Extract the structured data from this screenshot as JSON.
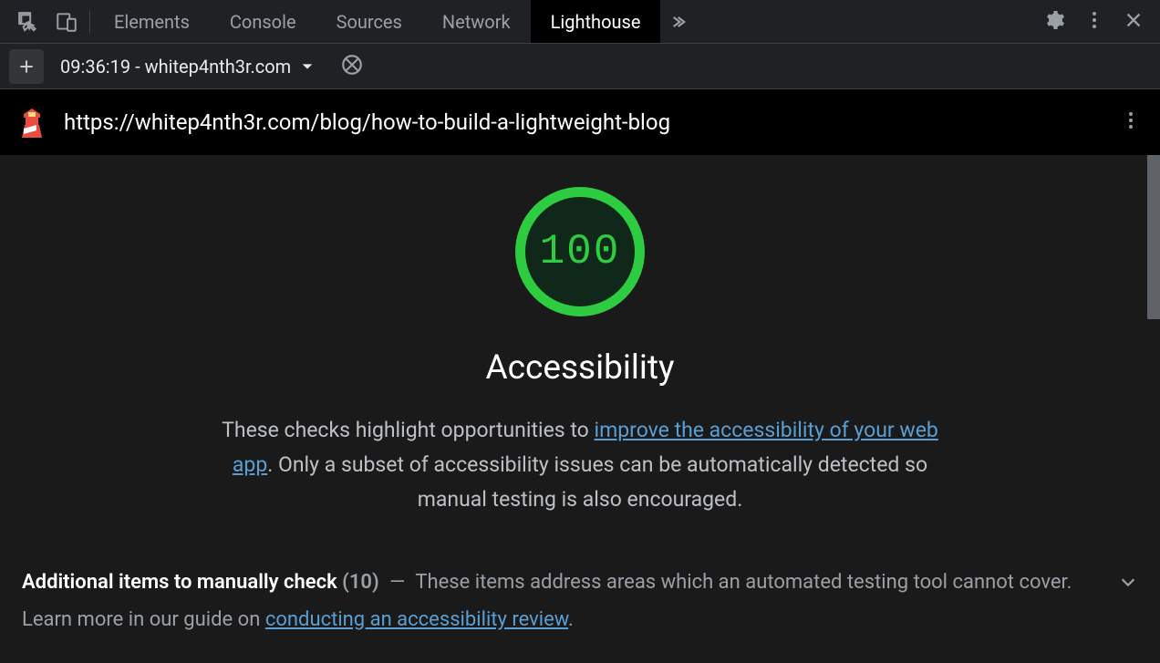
{
  "tabs": {
    "elements": "Elements",
    "console": "Console",
    "sources": "Sources",
    "network": "Network",
    "lighthouse": "Lighthouse"
  },
  "secondaryBar": {
    "reportLabel": "09:36:19 - whitep4nth3r.com"
  },
  "urlBar": {
    "url": "https://whitep4nth3r.com/blog/how-to-build-a-lightweight-blog"
  },
  "score": {
    "value": "100",
    "category": "Accessibility",
    "descPart1": "These checks highlight opportunities to ",
    "descLink1": "improve the accessibility of your web app",
    "descPart2": ". Only a subset of accessibility issues can be automatically detected so manual testing is also encouraged."
  },
  "manual": {
    "title": "Additional items to manually check",
    "count": "(10)",
    "dash": "—",
    "descPart1": "These items address areas which an automated testing tool cannot cover. Learn more in our guide on ",
    "descLink": "conducting an accessibility review",
    "descEnd": "."
  }
}
